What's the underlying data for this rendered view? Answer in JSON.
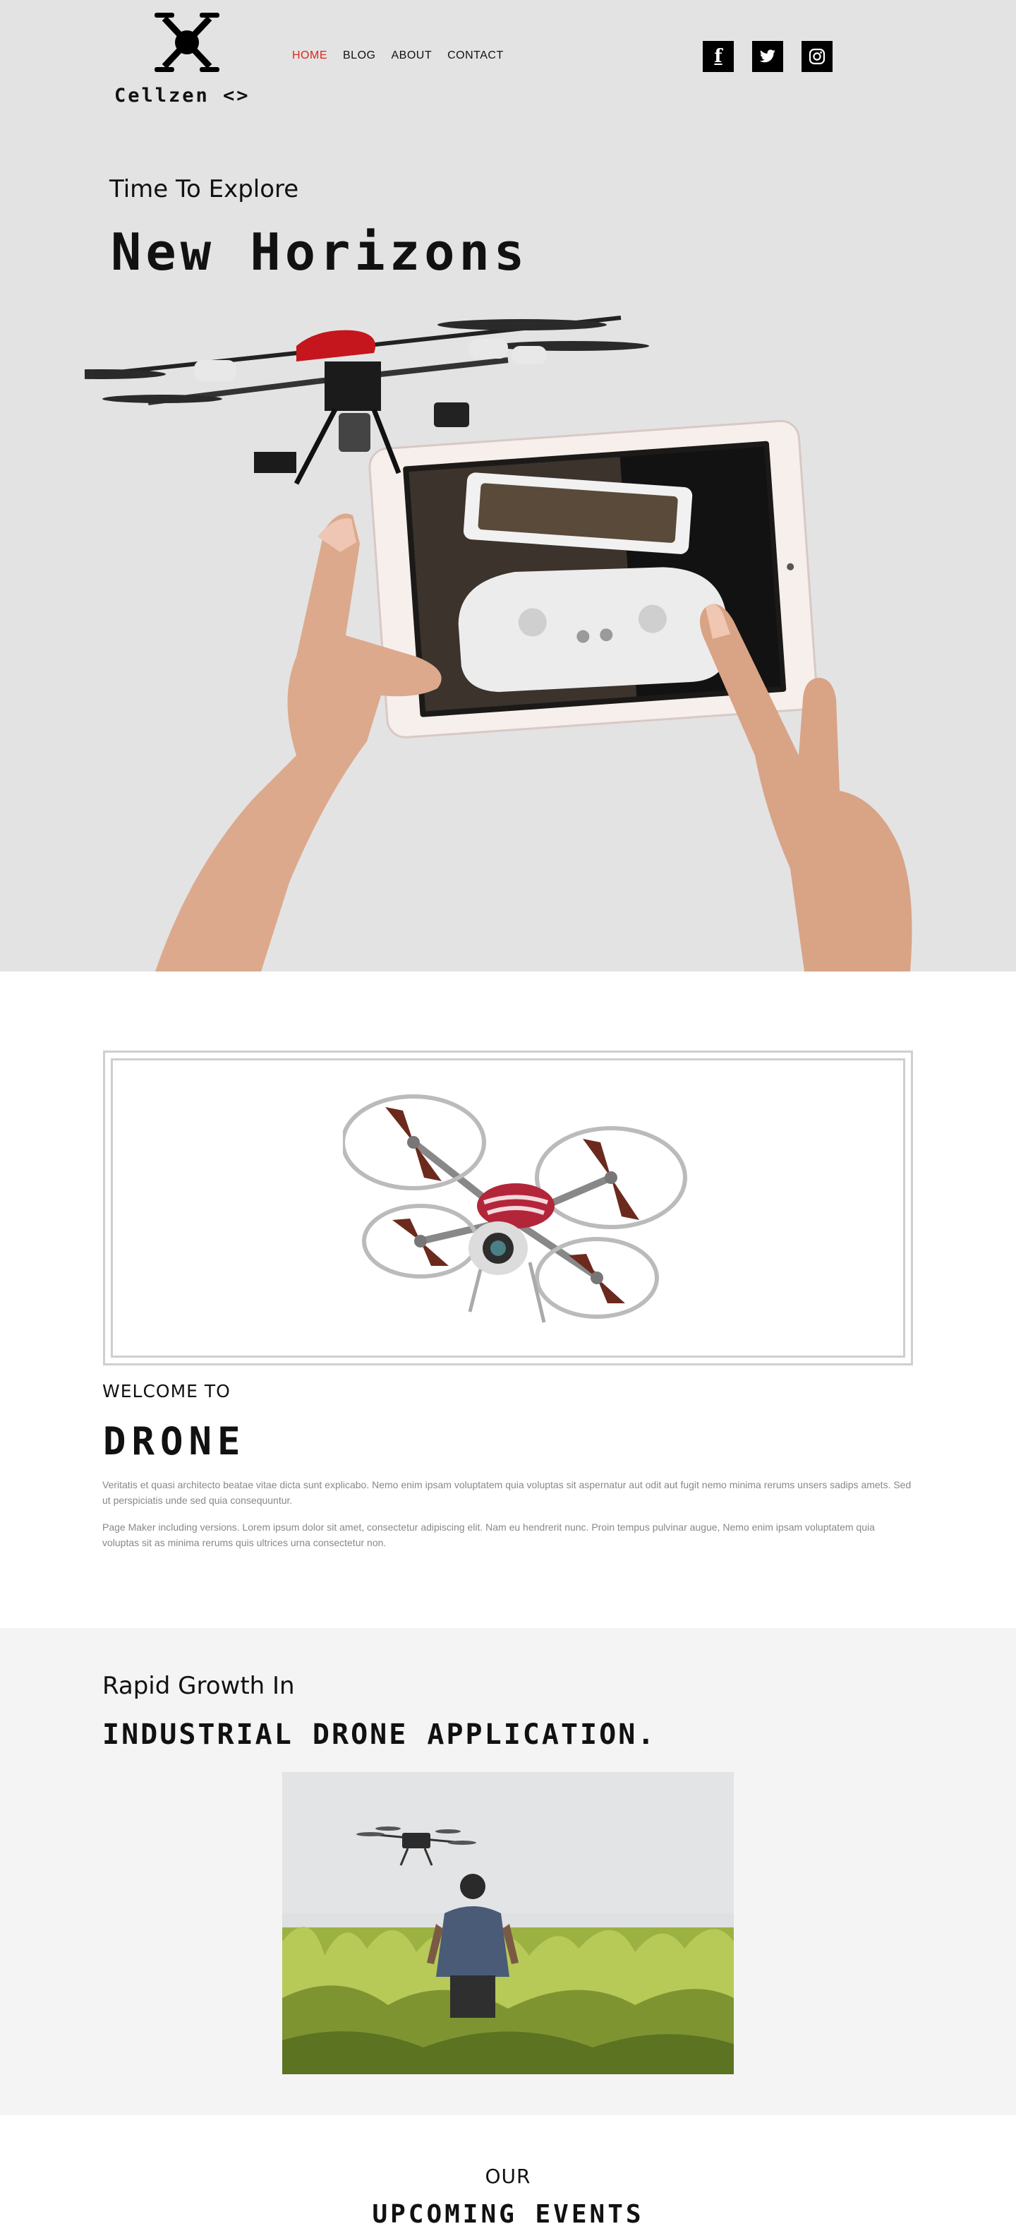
{
  "brand": {
    "name": "Cellzen <>"
  },
  "nav": [
    {
      "label": "HOME",
      "active": true
    },
    {
      "label": "BLOG",
      "active": false
    },
    {
      "label": "ABOUT",
      "active": false
    },
    {
      "label": "CONTACT",
      "active": false
    }
  ],
  "socials": [
    {
      "icon": "facebook-icon",
      "glyph": "f"
    },
    {
      "icon": "twitter-icon",
      "glyph": "t"
    },
    {
      "icon": "instagram-icon",
      "glyph": "◎"
    }
  ],
  "hero": {
    "kicker": "Time To Explore",
    "title": "New Horizons",
    "image": "hands-holding-tablet-with-drone-image"
  },
  "welcome": {
    "image": "quadcopter-drone-image",
    "kicker": "WELCOME TO",
    "title": "DRONE",
    "paragraphs": [
      "Veritatis et quasi architecto beatae vitae dicta sunt explicabo. Nemo enim ipsam voluptatem quia voluptas sit aspernatur aut odit aut fugit nemo minima rerums unsers sadips amets. Sed ut perspiciatis unde sed quia consequuntur.",
      "Page Maker including versions. Lorem ipsum dolor sit amet, consectetur adipiscing elit. Nam eu hendrerit nunc. Proin tempus pulvinar augue, Nemo enim ipsam voluptatem quia voluptas sit as minima rerums quis ultrices urna consectetur non."
    ]
  },
  "growth": {
    "kicker": "Rapid Growth In",
    "title": "INDUSTRIAL DRONE APPLICATION.",
    "image": "man-in-field-with-drone-photo"
  },
  "events": {
    "kicker": "OUR",
    "title": "UPCOMING EVENTS"
  },
  "colors": {
    "hero_bg": "#e3e3e4",
    "nav_active": "#e0231c",
    "section_alt_bg": "#f4f4f4",
    "text": "#111111",
    "muted_text": "#888888"
  }
}
